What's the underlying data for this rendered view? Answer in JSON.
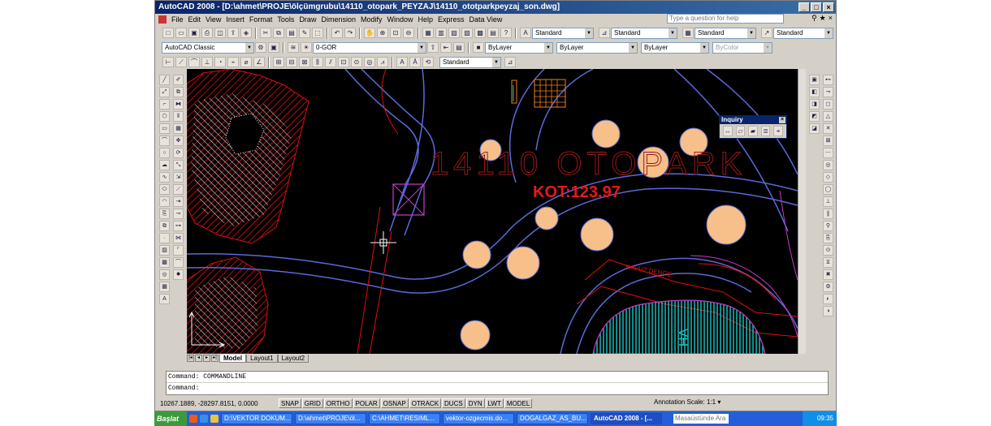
{
  "window": {
    "title": "AutoCAD 2008 - [D:\\ahmet\\PROJE\\ölçümgrubu\\14110_otopark_PEYZAJ\\14110_ototparkpeyzaj_son.dwg]",
    "controls": [
      "_",
      "□",
      "×"
    ]
  },
  "menu": {
    "items": [
      "File",
      "Edit",
      "View",
      "Insert",
      "Format",
      "Tools",
      "Draw",
      "Dimension",
      "Modify",
      "Window",
      "Help",
      "Express",
      "Data View"
    ],
    "help_placeholder": "Type a question for help"
  },
  "toolbar1": {
    "text_style": "Standard",
    "dim_style": "Standard",
    "table_style": "Standard",
    "mleader_style": "Standard"
  },
  "toolbar2": {
    "workspace": "AutoCAD Classic",
    "layer": "0-GOR",
    "color": "ByLayer",
    "linetype": "ByLayer",
    "lineweight": "ByLayer",
    "plotstyle": "ByColor"
  },
  "toolbar3": {
    "dim_style": "Standard"
  },
  "drawing": {
    "big_title": "14110 OTOPARK",
    "elevation": "KOT:123.97",
    "water_label": "HA",
    "label_havuz": "HAVUZ DENGE"
  },
  "layout_tabs": [
    "Model",
    "Layout1",
    "Layout2"
  ],
  "command": {
    "history": "Command:  COMMANDLINE",
    "prompt": "Command:"
  },
  "status": {
    "coords": "10267.1889, -28297.8151, 0.0000",
    "toggles": [
      "SNAP",
      "GRID",
      "ORTHO",
      "POLAR",
      "OSNAP",
      "OTRACK",
      "DUCS",
      "DYN",
      "LWT",
      "MODEL"
    ],
    "annotation_scale_label": "Annotation Scale:",
    "annotation_scale_value": "1:1"
  },
  "inquiry": {
    "title": "Inquiry"
  },
  "taskbar": {
    "start": "Başlat",
    "tasks": [
      "D:\\VEKTOR DOKUM...",
      "D:\\ahmet\\PROJE\\öl...",
      "C:\\AHMET\\RESIML...",
      "vektor-ozgecmis.do...",
      "DOGALGAZ_AS_BU...",
      "AutoCAD 2008 - [..."
    ],
    "search_placeholder": "Masaüstünde Ara",
    "clock": "09:35"
  },
  "colors": {
    "canvas": "#000000",
    "title_bar": "#0a246a",
    "tree_red": "#e01010",
    "path_blue": "#5a6ad8",
    "circle_fill": "#f7c08a",
    "text_red": "#e81818",
    "water_cyan": "#19c9c9",
    "magenta": "#c83bc8"
  }
}
